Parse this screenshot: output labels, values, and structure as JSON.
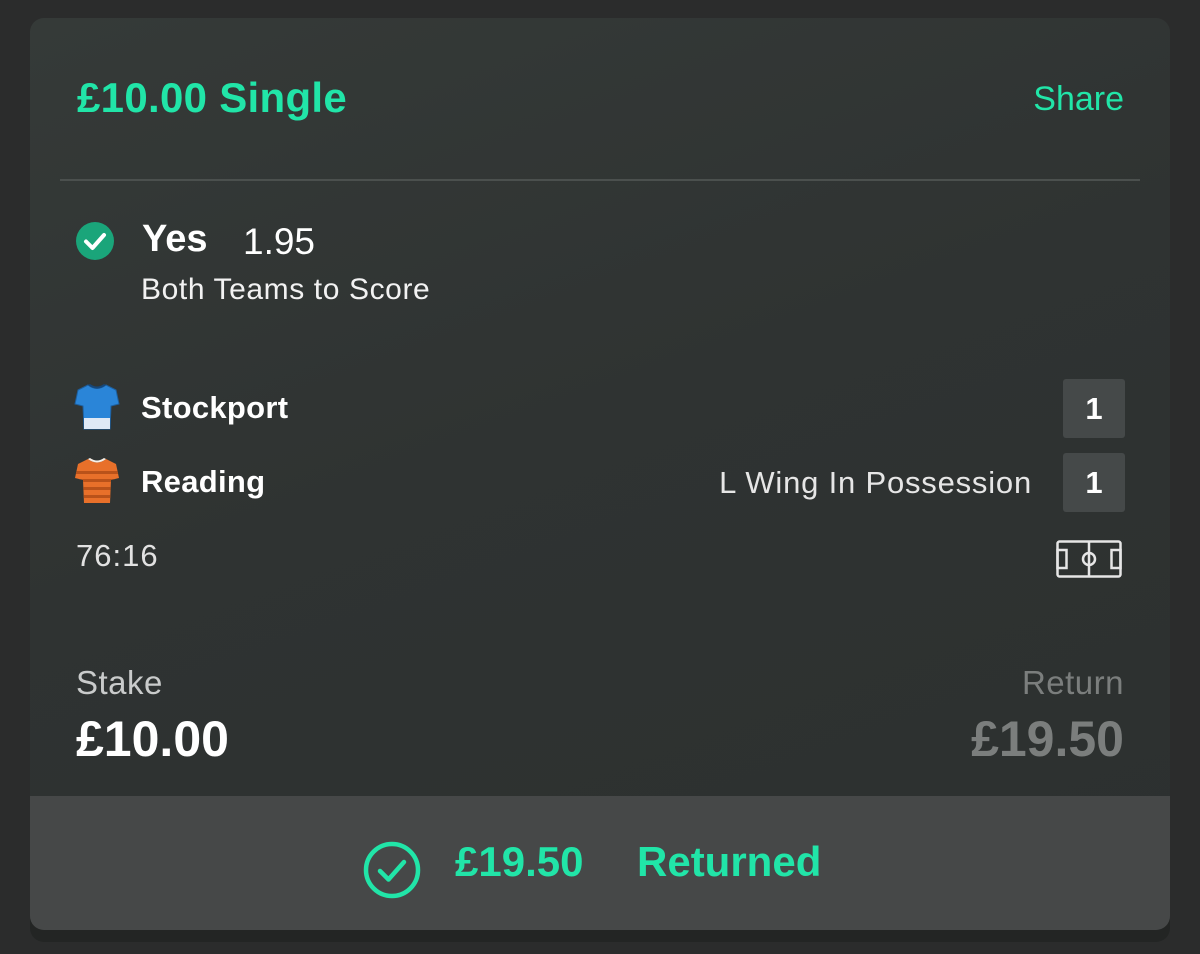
{
  "colors": {
    "accent": "#21e5a8",
    "win_check": "#1aa57a",
    "muted": "#7b7e7d",
    "score_box": "#454949",
    "footer_bg": "#464848",
    "stockport_shirt": "#2a85d8",
    "reading_shirt": "#e8702a"
  },
  "header": {
    "title": "£10.00 Single",
    "share_label": "Share"
  },
  "selection": {
    "status_icon": "check-circle-icon",
    "name": "Yes",
    "odds": "1.95",
    "market": "Both Teams to Score"
  },
  "match": {
    "teams": [
      {
        "name": "Stockport",
        "score": "1",
        "shirt_icon": "blue-shirt-icon",
        "status": ""
      },
      {
        "name": "Reading",
        "score": "1",
        "shirt_icon": "orange-striped-shirt-icon",
        "status": "L Wing In Possession"
      }
    ],
    "clock": "76:16",
    "pitch_icon": "pitch-icon"
  },
  "stake": {
    "label": "Stake",
    "value": "£10.00"
  },
  "return": {
    "label": "Return",
    "value": "£19.50"
  },
  "footer": {
    "icon": "check-circle-outline-icon",
    "amount": "£19.50",
    "label": "Returned"
  }
}
